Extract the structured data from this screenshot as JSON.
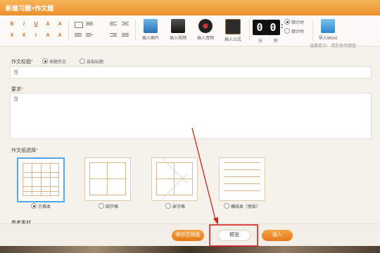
{
  "dialog": {
    "title": "新建习题>作文题"
  },
  "toolbar": {
    "format_buttons": [
      "B",
      "I",
      "U",
      "A",
      "A",
      "X",
      "X",
      "I",
      "A",
      "A"
    ],
    "insert": [
      {
        "label": "插入图片",
        "icon": "image-icon"
      },
      {
        "label": "插入视频",
        "icon": "video-icon"
      },
      {
        "label": "插入音频",
        "icon": "audio-icon"
      },
      {
        "label": "插入公式",
        "icon": "formula-icon"
      }
    ],
    "timer": {
      "digits": [
        "0",
        "0",
        "0",
        "0"
      ],
      "min_label": "分",
      "sec_label": "秒"
    },
    "timer_modes": [
      {
        "label": "顺计时",
        "selected": true
      },
      {
        "label": "倒计时",
        "selected": false
      }
    ],
    "import_label": "导入Word"
  },
  "hint": "温馨提示：请您使用键盘",
  "form": {
    "title_label": "作文标题",
    "title_required": "*",
    "title_options": [
      {
        "label": "命题作文",
        "selected": true
      },
      {
        "label": "自拟标题",
        "selected": false
      }
    ],
    "title_value": "当",
    "requirement_label": "要求",
    "requirement_required": "*",
    "requirement_value": "当",
    "paper_label": "作文纸选择",
    "paper_required": "*",
    "papers": [
      {
        "label": "方格本",
        "selected": true
      },
      {
        "label": "田字格",
        "selected": false
      },
      {
        "label": "米字格",
        "selected": false
      },
      {
        "label": "横线本（宽松）",
        "selected": false
      }
    ],
    "more_label": "参考素材"
  },
  "footer": {
    "save_label": "保存至网盘",
    "preview_label": "预览",
    "insert_label": "插入"
  },
  "annotation": {
    "color": "#d62020"
  }
}
